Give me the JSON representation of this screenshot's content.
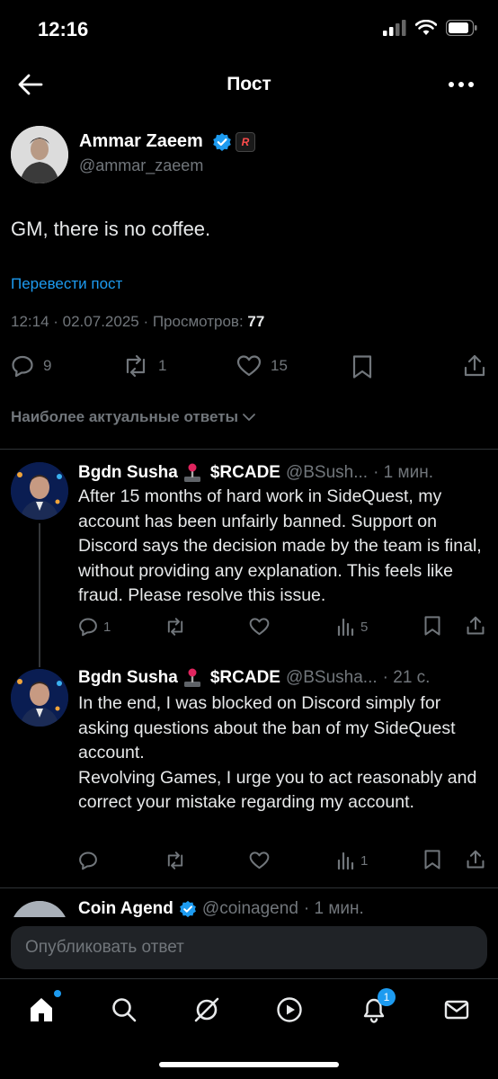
{
  "status_bar": {
    "time": "12:16"
  },
  "header": {
    "title": "Пост"
  },
  "post": {
    "author_name": "Ammar Zaeem",
    "author_badge": "R",
    "author_handle": "@ammar_zaeem",
    "text": "GM, there is no coffee.",
    "translate_label": "Перевести пост",
    "meta": "12:14 · 02.07.2025 · Просмотров: ",
    "views": "77",
    "replies_count": "9",
    "reposts_count": "1",
    "likes_count": "15"
  },
  "replies_filter": {
    "label": "Наиболее актуальные ответы"
  },
  "replies": [
    {
      "name": "Bgdn Susha",
      "ticker": "$RCADE",
      "handle": "@BSush...",
      "time": "· 1 мин.",
      "text": "After 15 months of hard work in SideQuest, my account has been unfairly banned. Support on Discord says the decision made by the team is final, without providing any explanation. This feels like fraud. Please resolve this issue.",
      "replies_count": "1",
      "views": "5"
    },
    {
      "name": "Bgdn Susha",
      "ticker": "$RCADE",
      "handle": "@BSusha...",
      "time": "· 21 с.",
      "text_lines": [
        "In the end, I was blocked on Discord simply for asking questions about the ban of my SideQuest account.",
        "Revolving Games, I urge you to act reasonably and correct your mistake regarding my account."
      ],
      "views": "1"
    },
    {
      "name": "Coin Agend",
      "handle": "@coinagend",
      "time": "· 1 мин."
    }
  ],
  "reply_input": {
    "placeholder": "Опубликовать ответ"
  },
  "tabbar": {
    "notifications_badge": "1"
  },
  "colors": {
    "accent": "#1d9bf0",
    "muted": "#71767b",
    "background": "#000000"
  }
}
